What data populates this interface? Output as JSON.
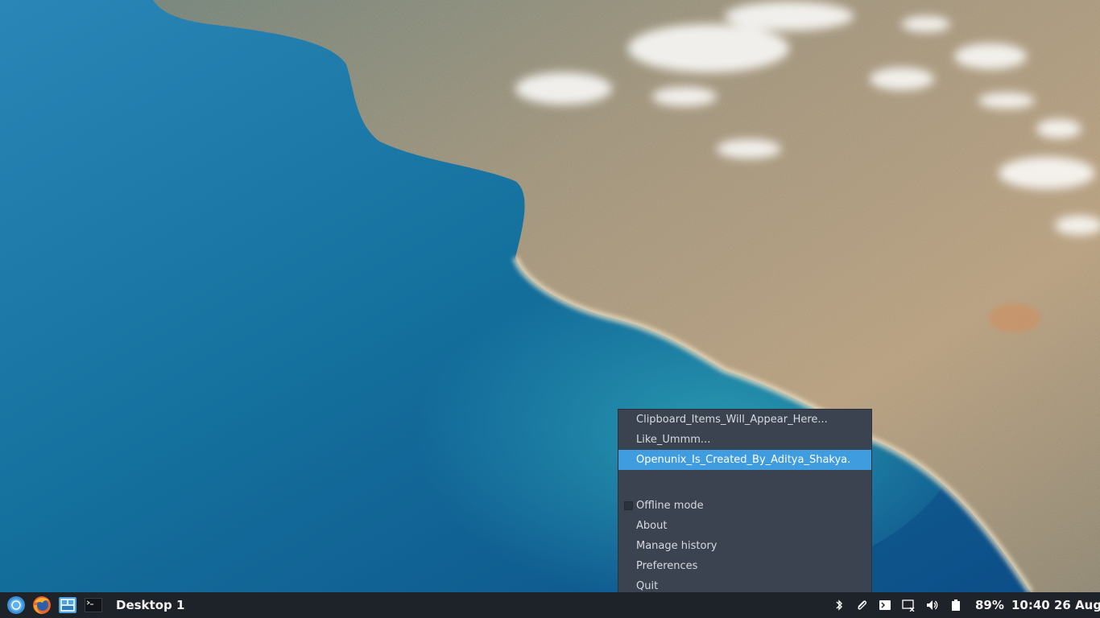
{
  "desktop": {
    "wallpaper": "aerial-coastline-photo"
  },
  "clipboard_menu": {
    "history_items": [
      {
        "label": "Clipboard_Items_Will_Appear_Here..."
      },
      {
        "label": "Like_Ummm..."
      },
      {
        "label": "Openunix_Is_Created_By_Aditya_Shakya.",
        "selected": true
      }
    ],
    "offline_mode": {
      "label": "Offline mode",
      "checked": false
    },
    "about_label": "About",
    "manage_history_label": "Manage history",
    "preferences_label": "Preferences",
    "quit_label": "Quit"
  },
  "taskbar": {
    "launchers": [
      {
        "name": "app-menu-icon"
      },
      {
        "name": "firefox-icon"
      },
      {
        "name": "file-manager-icon"
      },
      {
        "name": "terminal-icon"
      }
    ],
    "desktop_label": "Desktop 1",
    "tray": {
      "icons": [
        "bluetooth-icon",
        "clipboard-icon",
        "terminal-icon",
        "display-icon",
        "volume-icon",
        "battery-icon"
      ],
      "battery_percent": "89%",
      "clock": "10:40 26 Aug"
    }
  },
  "colors": {
    "menu_bg": "#3b4250",
    "menu_selected": "#3f9cdf",
    "taskbar_bg": "#1e2329"
  }
}
